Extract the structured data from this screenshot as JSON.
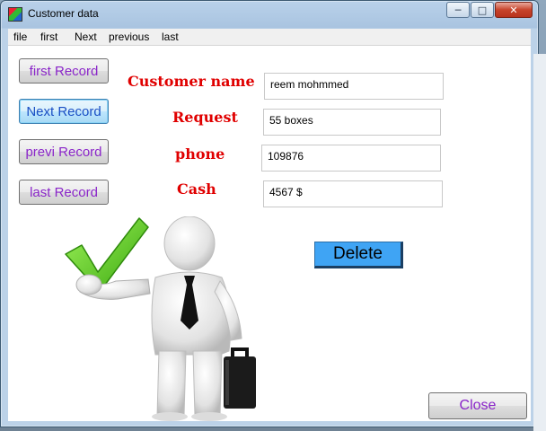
{
  "window": {
    "title": "Customer data"
  },
  "menu": {
    "items": [
      "file",
      "first",
      "Next",
      "previous",
      "last"
    ]
  },
  "nav_buttons": {
    "first": "first Record",
    "next": "Next Record",
    "previous": "previ Record",
    "last": "last Record"
  },
  "fields": {
    "customer_name": {
      "label": "Customer name",
      "value": "reem mohmmed"
    },
    "request": {
      "label": "Request",
      "value": "55 boxes"
    },
    "phone": {
      "label": "phone",
      "value": "109876"
    },
    "cash": {
      "label": "Cash",
      "value": "4567 $"
    }
  },
  "actions": {
    "delete": "Delete",
    "close": "Close"
  },
  "colors": {
    "label_red": "#e00000",
    "button_text_purple": "#8a25c9",
    "delete_blue": "#3fa4f4",
    "checkmark_green": "#5ad21c"
  }
}
